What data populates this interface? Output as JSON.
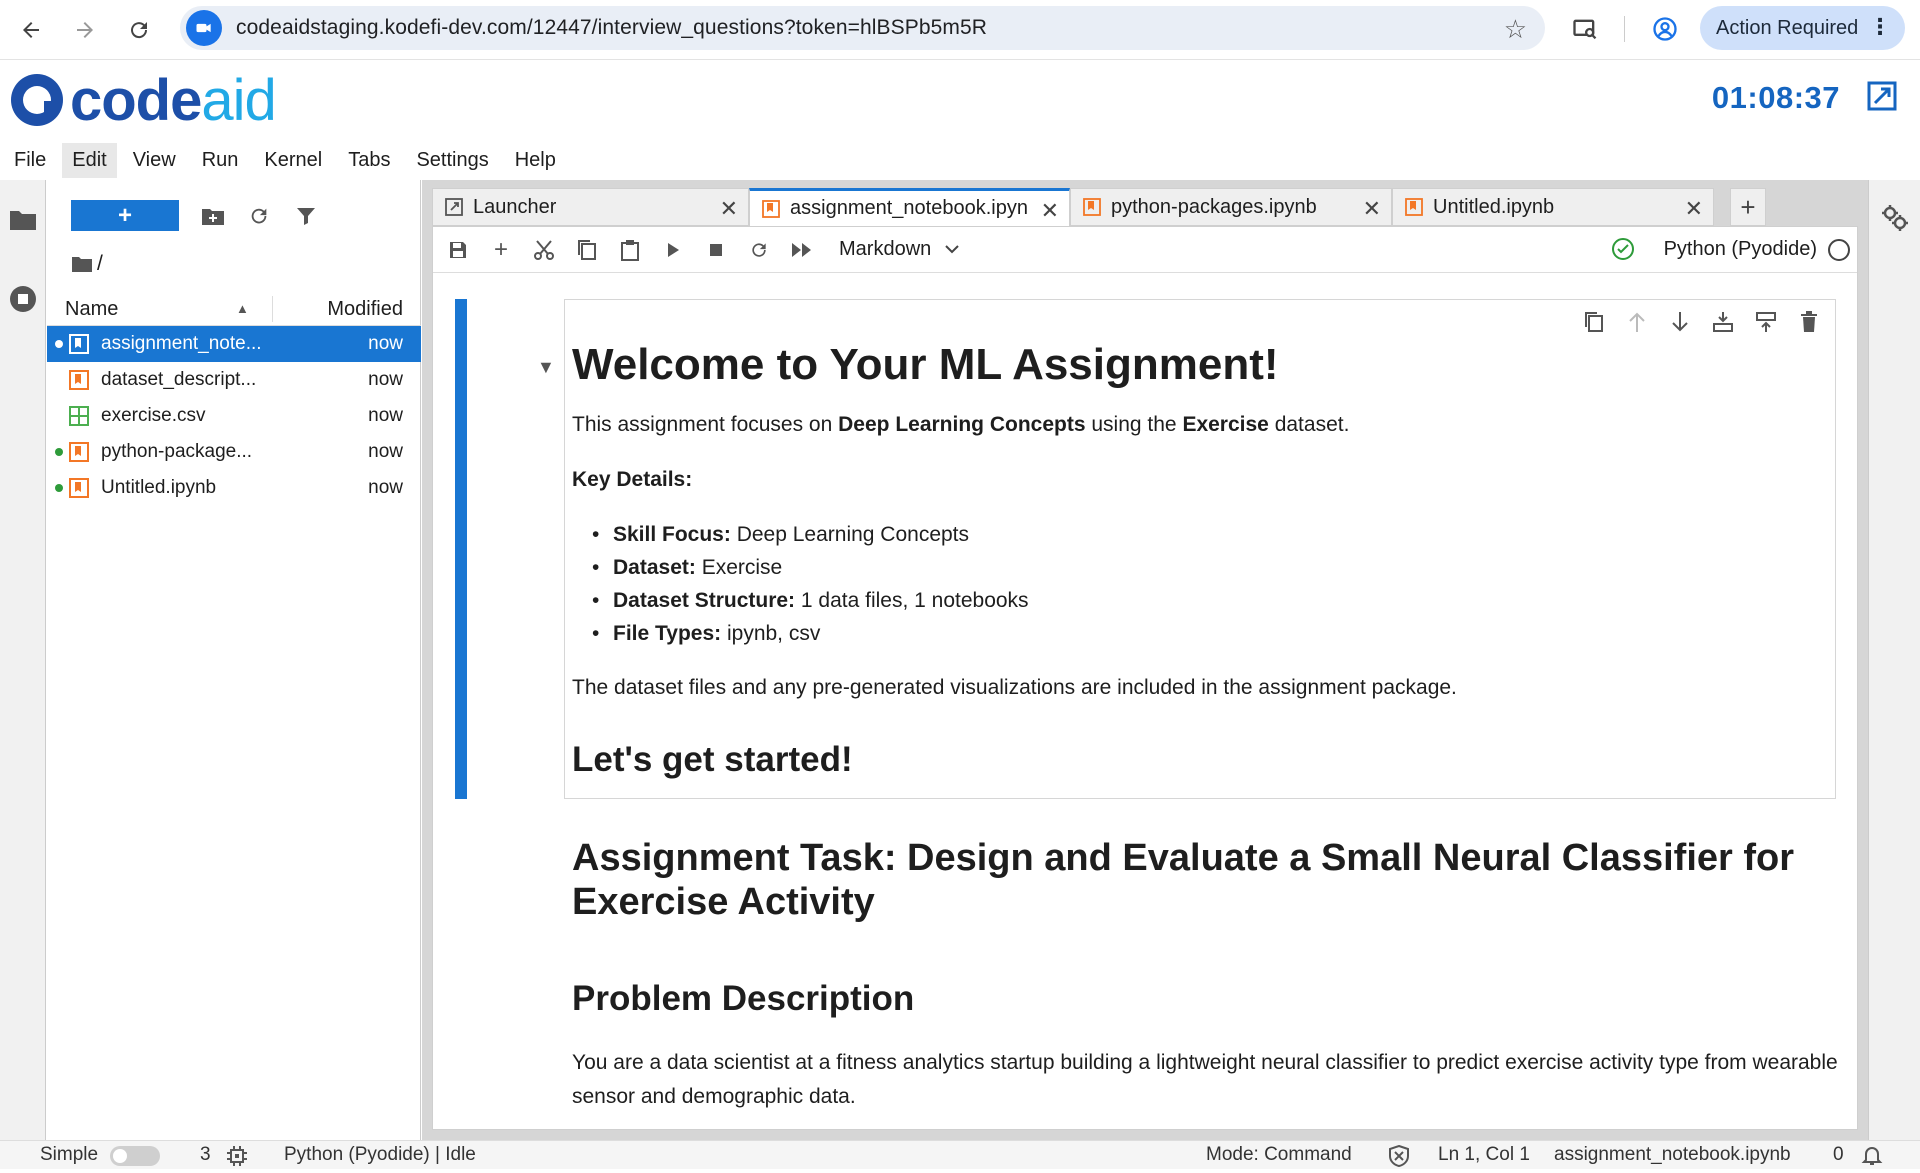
{
  "browser": {
    "url": "codeaidstaging.kodefi-dev.com/12447/interview_questions?token=hlBSPb5m5R",
    "action_label": "Action Required"
  },
  "app": {
    "logo_code": "code",
    "logo_aid": "aid",
    "timer": "01:08:37",
    "colors": {
      "accent": "#1976d2",
      "brand": "#1d4fa8",
      "brand_light": "#22a9e6",
      "notebook_icon": "#f37726",
      "csv_icon": "#4caf50",
      "running_dot": "#2e9b3a"
    }
  },
  "menu": [
    "File",
    "Edit",
    "View",
    "Run",
    "Kernel",
    "Tabs",
    "Settings",
    "Help"
  ],
  "filebrowser": {
    "new_label": "+",
    "path": "/",
    "col_name": "Name",
    "col_modified": "Modified",
    "files": [
      {
        "name": "assignment_note...",
        "modified": "now",
        "kind": "notebook",
        "running": true,
        "selected": true
      },
      {
        "name": "dataset_descript...",
        "modified": "now",
        "kind": "notebook",
        "running": false,
        "selected": false
      },
      {
        "name": "exercise.csv",
        "modified": "now",
        "kind": "csv",
        "running": false,
        "selected": false
      },
      {
        "name": "python-package...",
        "modified": "now",
        "kind": "notebook",
        "running": true,
        "selected": false
      },
      {
        "name": "Untitled.ipynb",
        "modified": "now",
        "kind": "notebook",
        "running": true,
        "selected": false
      }
    ]
  },
  "tabs": [
    {
      "label": "Launcher",
      "kind": "launcher",
      "active": false
    },
    {
      "label": "assignment_notebook.ipyn",
      "kind": "notebook",
      "active": true
    },
    {
      "label": "python-packages.ipynb",
      "kind": "notebook",
      "active": false
    },
    {
      "label": "Untitled.ipynb",
      "kind": "notebook",
      "active": false
    }
  ],
  "toolbar": {
    "cell_type": "Markdown",
    "kernel": "Python (Pyodide)"
  },
  "notebook": {
    "title": "Welcome to Your ML Assignment!",
    "intro_pre": "This assignment focuses on ",
    "intro_b1": "Deep Learning Concepts",
    "intro_mid": " using the ",
    "intro_b2": "Exercise",
    "intro_post": " dataset.",
    "key_details": "Key Details:",
    "details": [
      {
        "label": "Skill Focus:",
        "value": " Deep Learning Concepts"
      },
      {
        "label": "Dataset:",
        "value": " Exercise"
      },
      {
        "label": "Dataset Structure:",
        "value": " 1 data files, 1 notebooks"
      },
      {
        "label": "File Types:",
        "value": " ipynb, csv"
      }
    ],
    "files_note": "The dataset files and any pre-generated visualizations are included in the assignment package.",
    "get_started": "Let's get started!",
    "task_heading": "Assignment Task: Design and Evaluate a Small Neural Classifier for Exercise Activity",
    "problem_heading": "Problem Description",
    "problem_text": "You are a data scientist at a fitness analytics startup building a lightweight neural classifier to predict exercise activity type from wearable sensor and demographic data."
  },
  "statusbar": {
    "mode_simple": "Simple",
    "count": "3",
    "kernel_status": "Python (Pyodide) | Idle",
    "mode": "Mode: Command",
    "position": "Ln 1, Col 1",
    "filename": "assignment_notebook.ipynb",
    "notifications": "0"
  }
}
